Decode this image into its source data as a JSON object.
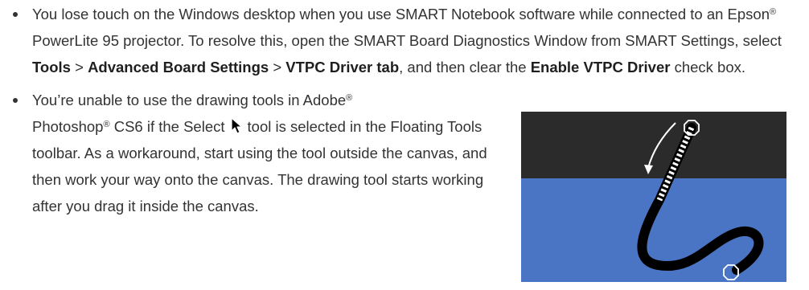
{
  "bullets": [
    {
      "t1": "You lose touch on the Windows desktop when you use SMART Notebook software while connected to an Epson",
      "reg1": "®",
      "t2": " PowerLite 95 projector. To resolve this, open the SMART Board Diagnostics Window from SMART Settings, select ",
      "b1": "Tools",
      "t3": " > ",
      "b2": "Advanced Board Settings",
      "t4": " > ",
      "b3": "VTPC Driver tab",
      "t5": ", and then clear the ",
      "b4": "Enable VTPC Driver",
      "t6": " check box."
    },
    {
      "t1": "You’re unable to use the drawing tools in Adobe",
      "reg1": "®",
      "t2": " Photoshop",
      "reg2": "®",
      "t3": " CS6 if the Select",
      "t4": "tool is selected in the Floating Tools toolbar. As a workaround, start using the tool outside the canvas, and then work your way onto the canvas. The drawing tool starts working after you drag it inside the canvas."
    }
  ],
  "icons": {
    "bullet_marker": "bullet-dot-icon",
    "inline_select_tool": "select-arrow-cursor-icon",
    "illustration_drag_arrow": "curved-arrow-icon",
    "illustration_handle": "handle-octagon-icon"
  },
  "colors": {
    "text": "#333333",
    "bold_text": "#1f1f1f",
    "illustration_background": "#2b2b2b",
    "canvas_blue": "#4a74c4",
    "stroke": "#000000",
    "outline": "#ffffff"
  }
}
